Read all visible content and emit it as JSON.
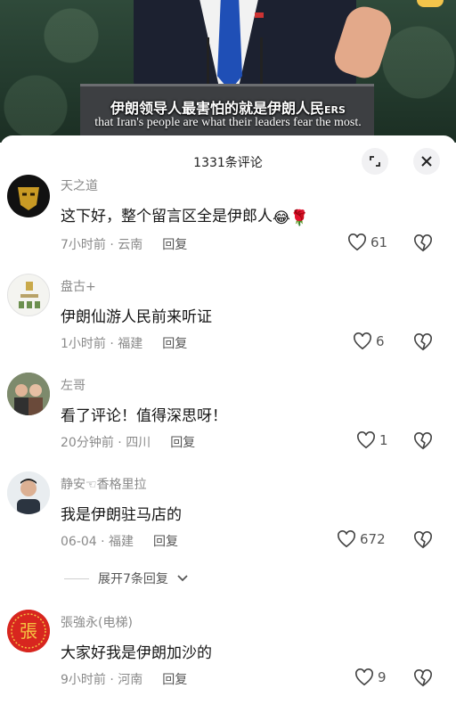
{
  "video": {
    "subtitle_zh": "伊朗领导人最害怕的就是伊朗人民",
    "subtitle_zh_tail": "ERS",
    "subtitle_en": "that Iran's people are what their leaders fear the most."
  },
  "comments_panel": {
    "title": "1331条评论",
    "expand_replies_label": "展开7条回复",
    "comments": [
      {
        "user": "天之道",
        "text": "这下好，整个留言区全是伊郎人",
        "emojis": [
          "😂",
          "🌹"
        ],
        "time": "7小时前",
        "location": "云南",
        "reply_label": "回复",
        "likes": "61",
        "avatar": "gold-mask-avatar"
      },
      {
        "user": "盘古+",
        "text": "伊朗仙游人民前来听证",
        "time": "1小时前",
        "location": "福建",
        "reply_label": "回复",
        "likes": "6",
        "avatar": "logo-avatar"
      },
      {
        "user": "左哥",
        "text": "看了评论！值得深思呀！",
        "time": "20分钟前",
        "location": "四川",
        "reply_label": "回复",
        "likes": "1",
        "avatar": "couple-photo-avatar"
      },
      {
        "user": "静安☜香格里拉",
        "text": "我是伊朗驻马店的",
        "time": "06-04",
        "location": "福建",
        "reply_label": "回复",
        "likes": "672",
        "avatar": "man-photo-avatar"
      },
      {
        "user": "張強永(电梯)",
        "text": "大家好我是伊朗加沙的",
        "time": "9小时前",
        "location": "河南",
        "reply_label": "回复",
        "likes": "9",
        "avatar": "red-seal-avatar",
        "avatar_char": "張"
      }
    ]
  },
  "colors": {
    "seal_red": "#d8261f",
    "meta_gray": "#8a8a8a",
    "like_gray": "#555555"
  }
}
